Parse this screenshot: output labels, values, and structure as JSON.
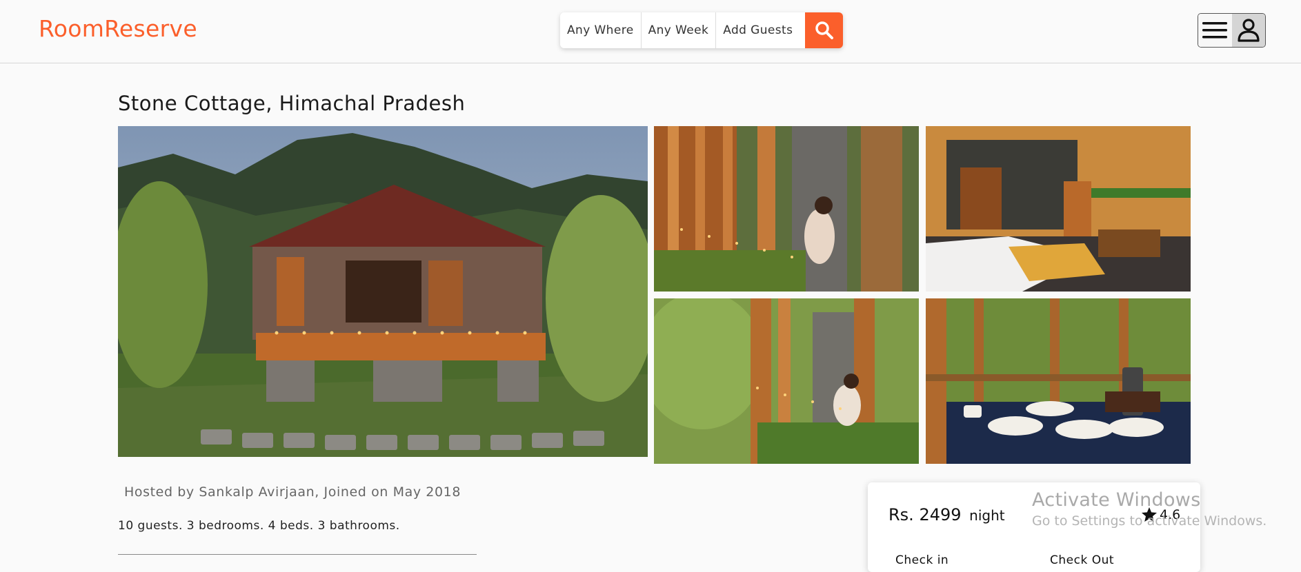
{
  "header": {
    "logo": "RoomReserve",
    "search": {
      "where": "Any Where",
      "week": "Any Week",
      "guests": "Add Guests"
    },
    "colors": {
      "brand": "#fb5f2b"
    }
  },
  "listing": {
    "title": "Stone Cottage, Himachal Pradesh",
    "host": "Hosted by Sankalp Avirjaan, Joined on May 2018",
    "specs": "10 guests. 3 bedrooms. 4 beds. 3 bathrooms.",
    "photos": [
      "cottage-exterior",
      "porch-woman-tea",
      "wooden-bedroom",
      "porch-side-view",
      "breakfast-table"
    ]
  },
  "booking": {
    "price": "Rs. 2499",
    "unit": "night",
    "rating": "4.6",
    "check_in_label": "Check in",
    "check_out_label": "Check Out"
  },
  "watermark": {
    "title": "Activate Windows",
    "subtitle": "Go to Settings to activate Windows."
  }
}
